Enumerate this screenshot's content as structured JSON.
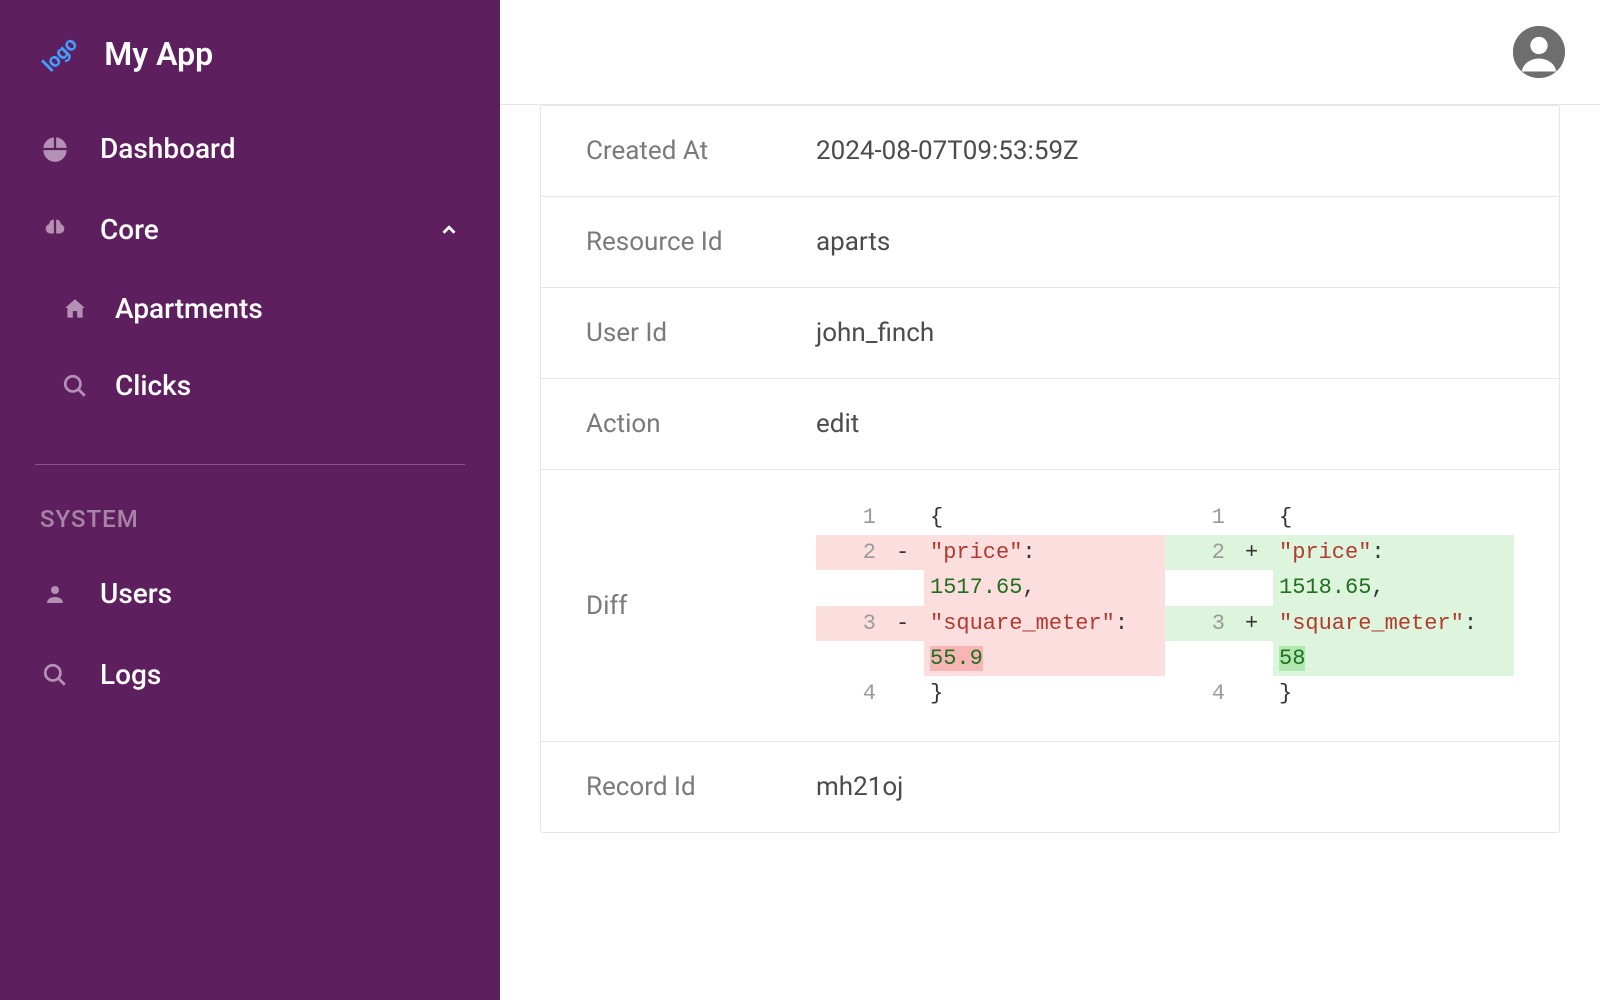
{
  "app": {
    "title": "My App",
    "logo_text": "logo"
  },
  "sidebar": {
    "items": [
      {
        "label": "Dashboard"
      },
      {
        "label": "Core"
      },
      {
        "label": "Apartments"
      },
      {
        "label": "Clicks"
      }
    ],
    "section_label": "SYSTEM",
    "system_items": [
      {
        "label": "Users"
      },
      {
        "label": "Logs"
      }
    ]
  },
  "detail": {
    "created_at": {
      "label": "Created At",
      "value": "2024-08-07T09:53:59Z"
    },
    "resource_id": {
      "label": "Resource Id",
      "value": "aparts"
    },
    "user_id": {
      "label": "User Id",
      "value": "john_finch"
    },
    "action": {
      "label": "Action",
      "value": "edit"
    },
    "diff": {
      "label": "Diff",
      "left": {
        "line1": {
          "num": "1",
          "marker": "",
          "text": "{"
        },
        "line2": {
          "num": "2",
          "marker": "-",
          "key": "\"price\"",
          "sep": ": ",
          "val": "1517.65",
          "end": ","
        },
        "line3": {
          "num": "3",
          "marker": "-",
          "key": "\"square_meter\"",
          "sep": ": ",
          "val": "55.9"
        },
        "line4": {
          "num": "4",
          "marker": "",
          "text": "}"
        }
      },
      "right": {
        "line1": {
          "num": "1",
          "marker": "",
          "text": "{"
        },
        "line2": {
          "num": "2",
          "marker": "+",
          "key": "\"price\"",
          "sep": ": ",
          "val": "1518.65",
          "end": ","
        },
        "line3": {
          "num": "3",
          "marker": "+",
          "key": "\"square_meter\"",
          "sep": ": ",
          "val": "58"
        },
        "line4": {
          "num": "4",
          "marker": "",
          "text": "}"
        }
      }
    },
    "record_id": {
      "label": "Record Id",
      "value": "mh21oj"
    }
  }
}
